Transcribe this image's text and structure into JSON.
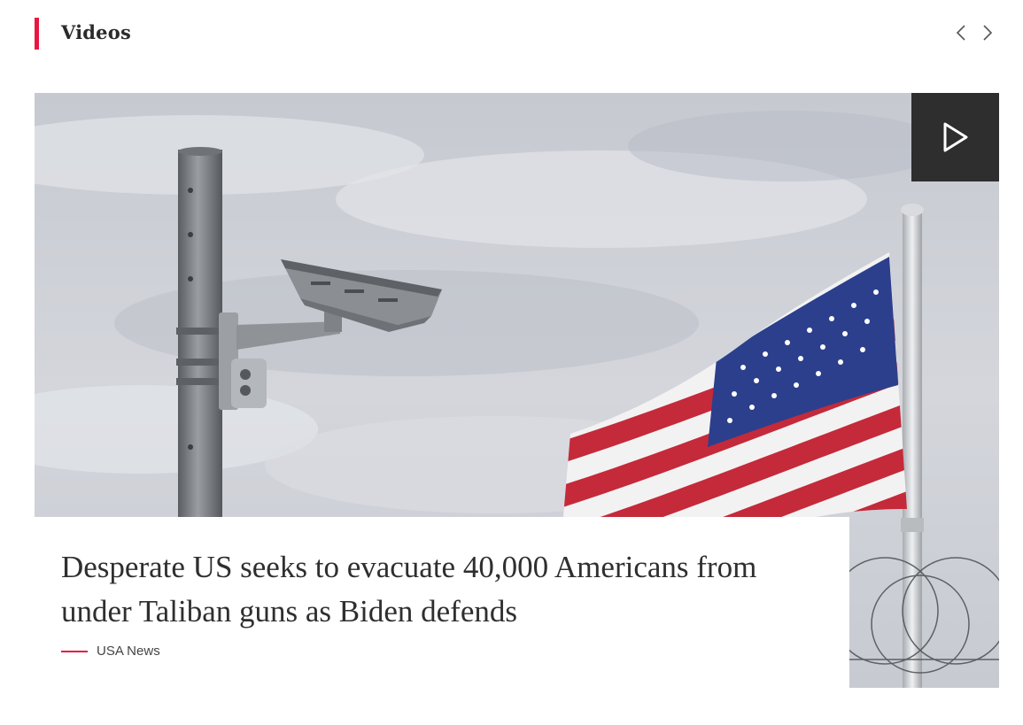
{
  "section": {
    "title": "Videos",
    "accent_color": "#e8173f",
    "prev_icon": "chevron-left-icon",
    "next_icon": "chevron-right-icon"
  },
  "featured": {
    "headline": "Desperate US seeks to evacuate 40,000 Americans from under Taliban guns as Biden defends",
    "category": "USA News",
    "play_icon": "play-icon",
    "image_subject": "surveillance camera on pole and American flag under cloudy sky with barbed wire"
  }
}
